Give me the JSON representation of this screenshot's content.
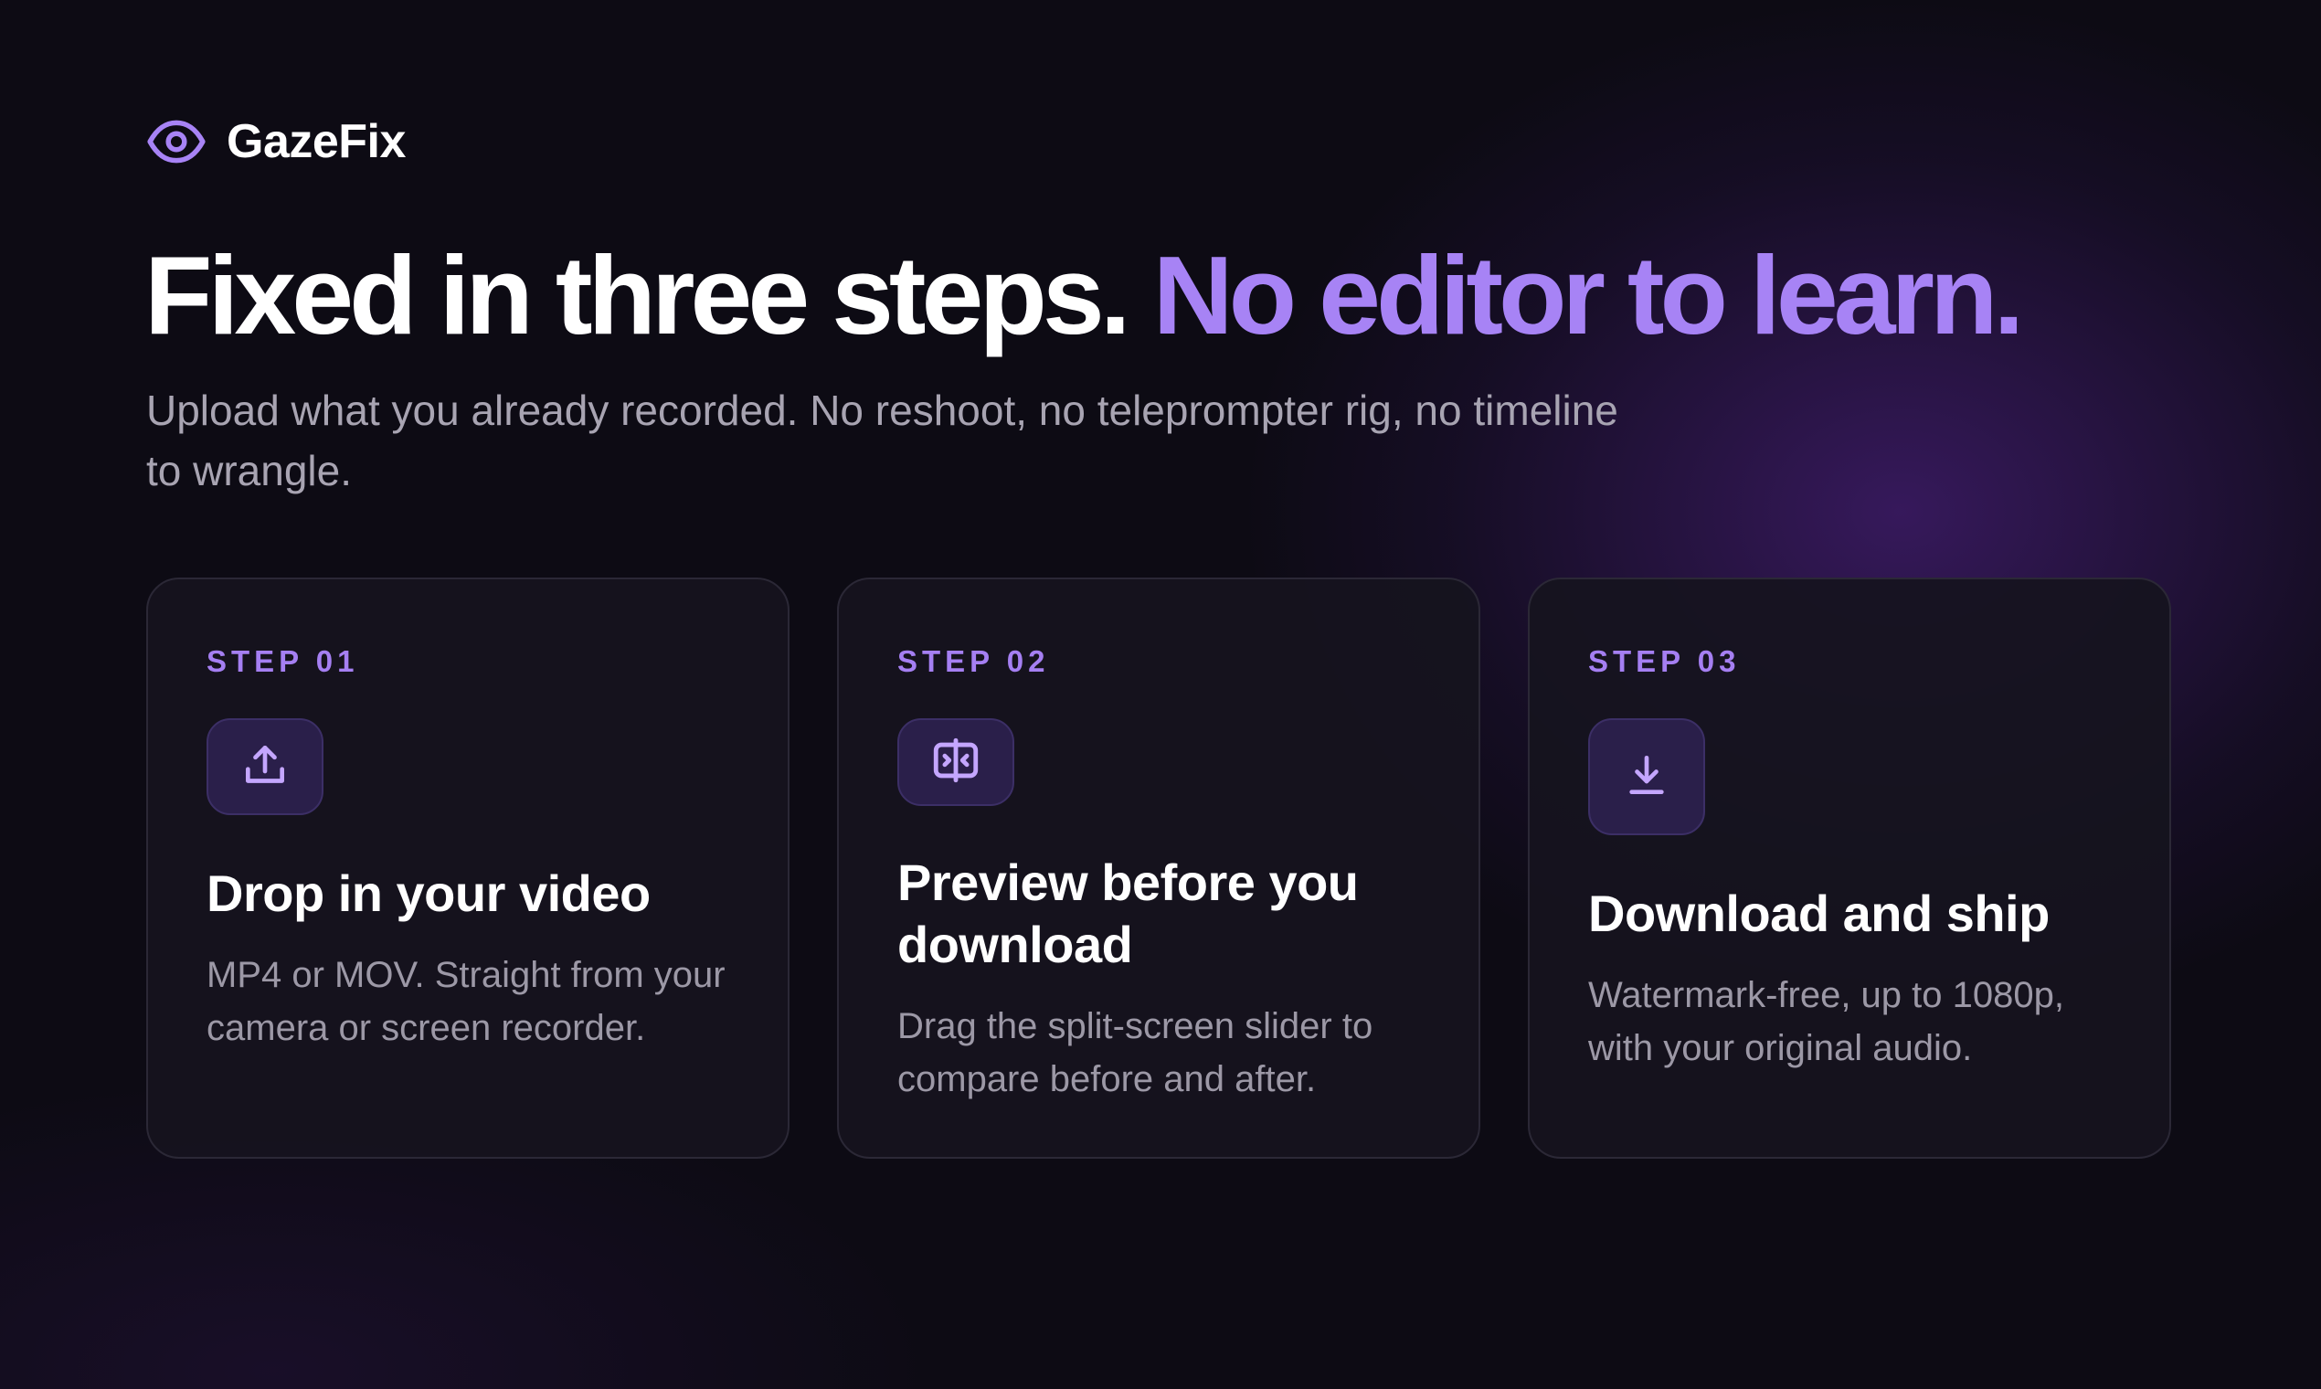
{
  "brand": {
    "name": "GazeFix",
    "icon": "eye-icon",
    "accent_color": "#a783f5"
  },
  "hero": {
    "headline_main": "Fixed in three steps.",
    "headline_accent": "No editor to learn.",
    "subhead": "Upload what you already recorded. No reshoot, no teleprompter rig, no timeline to wrangle."
  },
  "steps": [
    {
      "label": "STEP 01",
      "icon": "upload-icon",
      "title": "Drop in your video",
      "description": "MP4 or MOV. Straight from your camera or screen recorder."
    },
    {
      "label": "STEP 02",
      "icon": "split-screen-icon",
      "title": "Preview before you download",
      "description": "Drag the split-screen slider to compare before and after."
    },
    {
      "label": "STEP 03",
      "icon": "download-icon",
      "title": "Download and ship",
      "description": "Watermark-free, up to 1080p, with your original audio."
    }
  ]
}
